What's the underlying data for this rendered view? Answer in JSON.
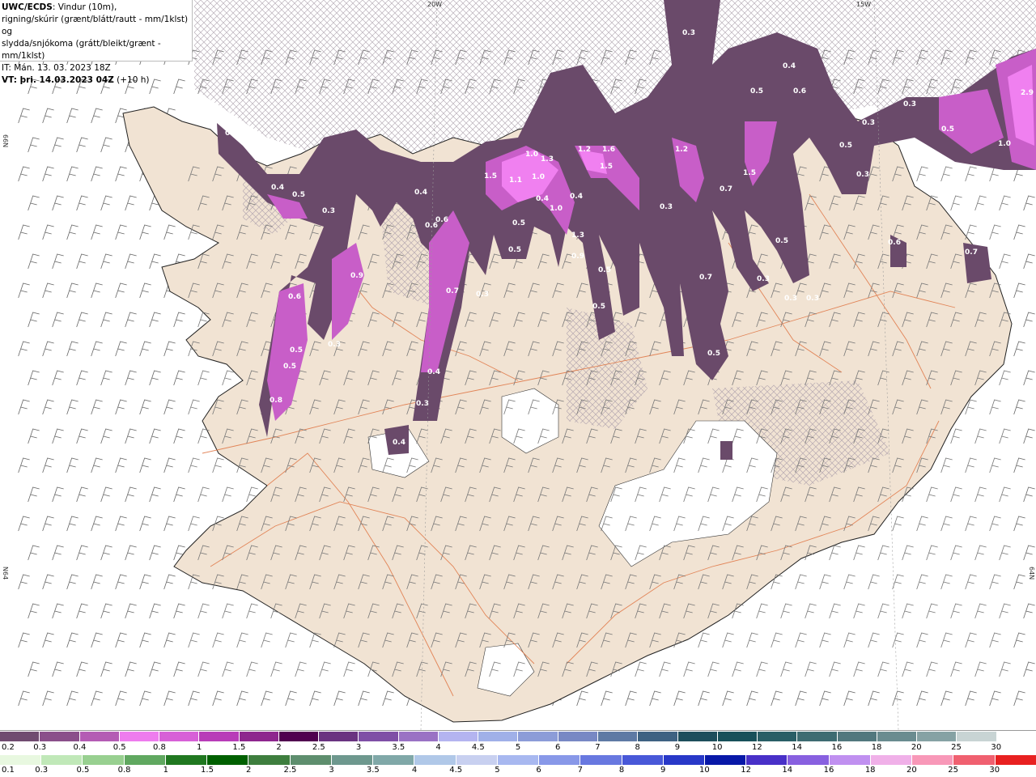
{
  "header": {
    "source_bold": "UWC/ECDS",
    "line1_rest": ": Vindur (10m),",
    "line2": "rigning/skúrir (grænt/blátt/rautt - mm/1klst) og",
    "line3": "slydda/snjókoma (grátt/bleikt/grænt - mm/1klst)",
    "line4": "IT: Mán. 13. 03. 2023 18Z",
    "line5_bold": "VT: þri. 14.03.2023 04Z",
    "line5_rest": " (+10 h)"
  },
  "grid_labels": {
    "top_a": "20W",
    "top_b": "15W",
    "left_upper": "66N",
    "left_lower": "N64",
    "right_lower": "64N"
  },
  "map": {
    "colors": {
      "land": "#f1e3d3",
      "sea": "#ffffff",
      "coast": "#222222",
      "road": "#e07a4a",
      "hatch": "#b0a8b0",
      "barb": "#555555",
      "glacier": "#ffffff"
    },
    "precip_values": [
      {
        "v": "0.4",
        "c": "#ffffff"
      },
      {
        "v": "0.4",
        "c": "#ffffff"
      },
      {
        "v": "0.5",
        "c": "#ffffff"
      },
      {
        "v": "0.3",
        "c": "#ffffff"
      },
      {
        "v": "0.6",
        "c": "#ffffff"
      },
      {
        "v": "0.5",
        "c": "#ffffff"
      },
      {
        "v": "0.5",
        "c": "#ffffff"
      },
      {
        "v": "0.8",
        "c": "#ffffff"
      },
      {
        "v": "0.9",
        "c": "#ffffff"
      },
      {
        "v": "0.3",
        "c": "#ffffff"
      },
      {
        "v": "0.4",
        "c": "#ffffff"
      },
      {
        "v": "0.6",
        "c": "#ffffff"
      },
      {
        "v": "0.6",
        "c": "#ffffff"
      },
      {
        "v": "0.7",
        "c": "#ffffff"
      },
      {
        "v": "1.0",
        "c": "#ffffff"
      },
      {
        "v": "0.4",
        "c": "#ffffff"
      },
      {
        "v": "0.3",
        "c": "#ffffff"
      },
      {
        "v": "0.4",
        "c": "#ffffff"
      },
      {
        "v": "1.5",
        "c": "#ffffff"
      },
      {
        "v": "1.1",
        "c": "#ffffff"
      },
      {
        "v": "1.0",
        "c": "#ffffff"
      },
      {
        "v": "1.3",
        "c": "#ffffff"
      },
      {
        "v": "1.0",
        "c": "#ffffff"
      },
      {
        "v": "0.4",
        "c": "#ffffff"
      },
      {
        "v": "0.5",
        "c": "#ffffff"
      },
      {
        "v": "0.5",
        "c": "#ffffff"
      },
      {
        "v": "1.3",
        "c": "#ffffff"
      },
      {
        "v": "1.2",
        "c": "#ffffff"
      },
      {
        "v": "1.6",
        "c": "#ffffff"
      },
      {
        "v": "1.5",
        "c": "#ffffff"
      },
      {
        "v": "0.9",
        "c": "#ffffff"
      },
      {
        "v": "0.5",
        "c": "#ffffff"
      },
      {
        "v": "0.5",
        "c": "#ffffff"
      },
      {
        "v": "0.3",
        "c": "#ffffff"
      },
      {
        "v": "0.3",
        "c": "#ffffff"
      },
      {
        "v": "1.2",
        "c": "#ffffff"
      },
      {
        "v": "0.7",
        "c": "#ffffff"
      },
      {
        "v": "1.5",
        "c": "#ffffff"
      },
      {
        "v": "0.5",
        "c": "#ffffff"
      },
      {
        "v": "0.3",
        "c": "#ffffff"
      },
      {
        "v": "0.7",
        "c": "#ffffff"
      },
      {
        "v": "0.5",
        "c": "#ffffff"
      },
      {
        "v": "0.3",
        "c": "#ffffff"
      },
      {
        "v": "0.3",
        "c": "#ffffff"
      },
      {
        "v": "0.4",
        "c": "#ffffff"
      },
      {
        "v": "0.5",
        "c": "#ffffff"
      },
      {
        "v": "0.6",
        "c": "#ffffff"
      },
      {
        "v": "0.3",
        "c": "#ffffff"
      },
      {
        "v": "0.5",
        "c": "#ffffff"
      },
      {
        "v": "0.3",
        "c": "#ffffff"
      },
      {
        "v": "0.5",
        "c": "#ffffff"
      },
      {
        "v": "1.0",
        "c": "#ffffff"
      },
      {
        "v": "2.9",
        "c": "#ffffff"
      },
      {
        "v": "0.6",
        "c": "#ffffff"
      },
      {
        "v": "0.7",
        "c": "#ffffff"
      },
      {
        "v": "0.4",
        "c": "#ffffff"
      },
      {
        "v": "0.3",
        "c": "#ffffff"
      },
      {
        "v": "0.3",
        "c": "#ffffff"
      }
    ]
  },
  "legend_snow": {
    "labels": [
      "0.2",
      "0.3",
      "0.4",
      "0.5",
      "0.8",
      "1",
      "1.5",
      "2",
      "2.5",
      "3",
      "3.5",
      "4",
      "4.5",
      "5",
      "6",
      "7",
      "8",
      "9",
      "10",
      "12",
      "14",
      "16",
      "18",
      "20",
      "25",
      "30"
    ],
    "colors": [
      "#704c70",
      "#8a4f8a",
      "#b45cb4",
      "#ee7cee",
      "#d760d7",
      "#b83cb8",
      "#8e268e",
      "#50004f",
      "#6a3380",
      "#7f4fa6",
      "#9a72c4",
      "#b4b4f0",
      "#a0b0e8",
      "#8c9cd8",
      "#7888c4",
      "#5e7aa4",
      "#3e6282",
      "#1e4e5c",
      "#18505a",
      "#2a5e66",
      "#3e6c72",
      "#52787e",
      "#6a8c90",
      "#86a2a4",
      "#c8d4d4",
      "#ffffff"
    ]
  },
  "legend_rain": {
    "labels": [
      "0.1",
      "0.3",
      "0.5",
      "0.8",
      "1",
      "1.5",
      "2",
      "2.5",
      "3",
      "3.5",
      "4",
      "4.5",
      "5",
      "6",
      "7",
      "8",
      "9",
      "10",
      "12",
      "14",
      "16",
      "18",
      "20",
      "25",
      "30"
    ],
    "colors": [
      "#e8f8e0",
      "#c0e8b8",
      "#98d090",
      "#60a860",
      "#207820",
      "#006000",
      "#3e7e3e",
      "#5e8e6e",
      "#6e988e",
      "#80a8a8",
      "#b0c8e8",
      "#c8d0f0",
      "#a8b8f0",
      "#8898e8",
      "#6878e0",
      "#4858d8",
      "#2838c8",
      "#0818a8",
      "#4830c8",
      "#8860e0",
      "#c090f0",
      "#f0b0e8",
      "#f898b8",
      "#f06070",
      "#e82020"
    ]
  }
}
